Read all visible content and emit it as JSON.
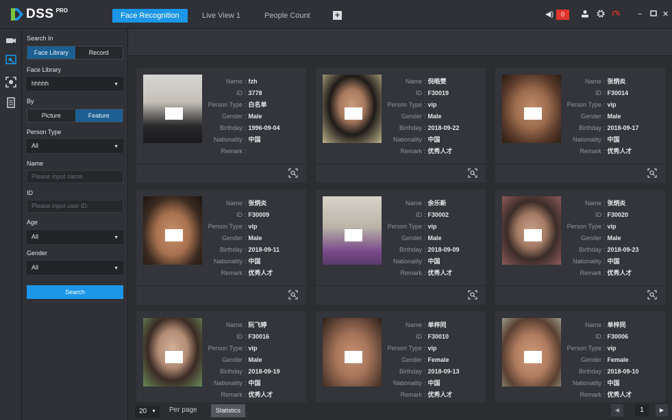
{
  "app": {
    "brand": "DSS",
    "brand_suffix": "PRO",
    "accent": "#1b96e8"
  },
  "tabs": [
    {
      "label": "Face Recognition",
      "active": true
    },
    {
      "label": "Live View 1",
      "active": false
    },
    {
      "label": "People Count",
      "active": false
    }
  ],
  "topbar": {
    "alarm_count": "0"
  },
  "filter": {
    "search_in_label": "Search In",
    "search_in_options": [
      "Face Library",
      "Record"
    ],
    "face_library_label": "Face Library",
    "face_library_value": "hhhhh",
    "by_label": "By",
    "by_options": [
      "Picture",
      "Feature"
    ],
    "person_type_label": "Person Type",
    "person_type_value": "All",
    "name_label": "Name",
    "name_placeholder": "Please input name.",
    "id_label": "ID",
    "id_placeholder": "Please input user ID.",
    "age_label": "Age",
    "age_value": "All",
    "gender_label": "Gender",
    "gender_value": "All",
    "search_button": "Search"
  },
  "field_labels": {
    "name": "Name",
    "id": "ID",
    "person_type": "Person Type",
    "gender": "Gender",
    "birthday": "Birthday",
    "nationality": "Nationality",
    "remark": "Remark"
  },
  "cards": [
    {
      "name": "fzh",
      "id": "3778",
      "person_type": "白名单",
      "gender": "Male",
      "birthday": "1996-09-04",
      "nationality": "中国",
      "remark": ""
    },
    {
      "name": "倪皓雯",
      "id": "F30019",
      "person_type": "vip",
      "gender": "Male",
      "birthday": "2018-09-22",
      "nationality": "中国",
      "remark": "优秀人才"
    },
    {
      "name": "张炳炎",
      "id": "F30014",
      "person_type": "vip",
      "gender": "Male",
      "birthday": "2018-09-17",
      "nationality": "中国",
      "remark": "优秀人才"
    },
    {
      "name": "张炳炎",
      "id": "F30009",
      "person_type": "vip",
      "gender": "Male",
      "birthday": "2018-09-11",
      "nationality": "中国",
      "remark": "优秀人才"
    },
    {
      "name": "余乐新",
      "id": "F30002",
      "person_type": "vip",
      "gender": "Male",
      "birthday": "2018-09-09",
      "nationality": "中国",
      "remark": "优秀人才"
    },
    {
      "name": "张炳炎",
      "id": "F30020",
      "person_type": "vip",
      "gender": "Male",
      "birthday": "2018-09-23",
      "nationality": "中国",
      "remark": "优秀人才"
    },
    {
      "name": "阮飞婷",
      "id": "F30016",
      "person_type": "vip",
      "gender": "Male",
      "birthday": "2018-09-19",
      "nationality": "中国",
      "remark": "优秀人才"
    },
    {
      "name": "单梓同",
      "id": "F30010",
      "person_type": "vip",
      "gender": "Female",
      "birthday": "2018-09-13",
      "nationality": "中国",
      "remark": "优秀人才"
    },
    {
      "name": "单梓同",
      "id": "F30006",
      "person_type": "vip",
      "gender": "Female",
      "birthday": "2018-09-10",
      "nationality": "中国",
      "remark": "优秀人才"
    }
  ],
  "pager": {
    "page_size": "20",
    "per_page_label": "Per page",
    "statistics_button": "Statistics",
    "current_page": "1"
  }
}
